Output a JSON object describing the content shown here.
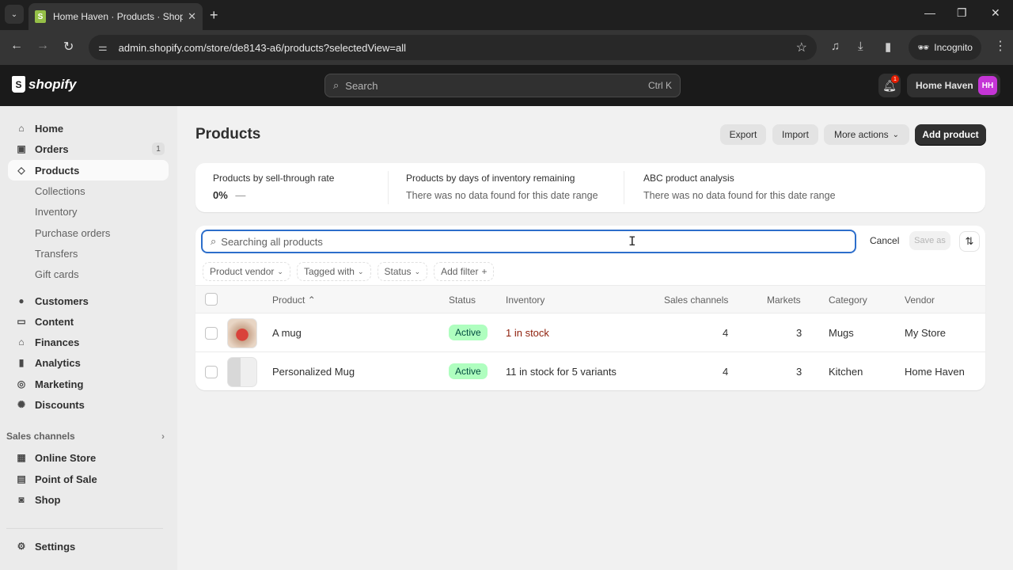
{
  "browser": {
    "tab_title": "Home Haven · Products · Shopify",
    "url": "admin.shopify.com/store/de8143-a6/products?selectedView=all",
    "incognito_label": "Incognito"
  },
  "topbar": {
    "logo_text": "shopify",
    "search_placeholder": "Search",
    "search_shortcut": "Ctrl K",
    "notification_count": "1",
    "store_name": "Home Haven",
    "avatar_initials": "HH"
  },
  "sidebar": {
    "items": [
      {
        "label": "Home",
        "icon": "home-icon"
      },
      {
        "label": "Orders",
        "icon": "inbox-icon",
        "count": "1"
      },
      {
        "label": "Products",
        "icon": "tag-icon",
        "active": true
      }
    ],
    "product_subitems": [
      "Collections",
      "Inventory",
      "Purchase orders",
      "Transfers",
      "Gift cards"
    ],
    "more_items": [
      {
        "label": "Customers",
        "icon": "person-icon"
      },
      {
        "label": "Content",
        "icon": "image-icon"
      },
      {
        "label": "Finances",
        "icon": "bank-icon"
      },
      {
        "label": "Analytics",
        "icon": "bar-chart-icon"
      },
      {
        "label": "Marketing",
        "icon": "target-icon"
      },
      {
        "label": "Discounts",
        "icon": "discount-icon"
      }
    ],
    "sales_channels_label": "Sales channels",
    "sales_channels": [
      {
        "label": "Online Store",
        "icon": "store-icon"
      },
      {
        "label": "Point of Sale",
        "icon": "pos-icon"
      },
      {
        "label": "Shop",
        "icon": "shop-icon"
      }
    ],
    "settings_label": "Settings"
  },
  "page": {
    "title": "Products",
    "actions": {
      "export": "Export",
      "import": "Import",
      "more_actions": "More actions",
      "add_product": "Add product"
    }
  },
  "metrics": [
    {
      "label": "Products by sell-through rate",
      "value": "0%",
      "trend": "—"
    },
    {
      "label": "Products by days of inventory remaining",
      "empty": "There was no data found for this date range"
    },
    {
      "label": "ABC product analysis",
      "empty": "There was no data found for this date range"
    }
  ],
  "filter_bar": {
    "search_placeholder": "Searching all products",
    "cancel": "Cancel",
    "save_as": "Save as",
    "filters": [
      "Product vendor",
      "Tagged with",
      "Status",
      "Add filter"
    ]
  },
  "table": {
    "columns": [
      "Product",
      "Status",
      "Inventory",
      "Sales channels",
      "Markets",
      "Category",
      "Vendor"
    ],
    "rows": [
      {
        "product": "A mug",
        "status": "Active",
        "inventory": "1 in stock",
        "sales_channels": "4",
        "markets": "3",
        "category": "Mugs",
        "vendor": "My Store"
      },
      {
        "product": "Personalized Mug",
        "status": "Active",
        "inventory": "11 in stock for 5 variants",
        "sales_channels": "4",
        "markets": "3",
        "category": "Kitchen",
        "vendor": "Home Haven"
      }
    ]
  },
  "colors": {
    "accent_focus": "#2c6ecb",
    "active_badge_bg": "#affebf",
    "low_stock_text": "#8e1f0b",
    "avatar_bg": "#c535d6"
  }
}
